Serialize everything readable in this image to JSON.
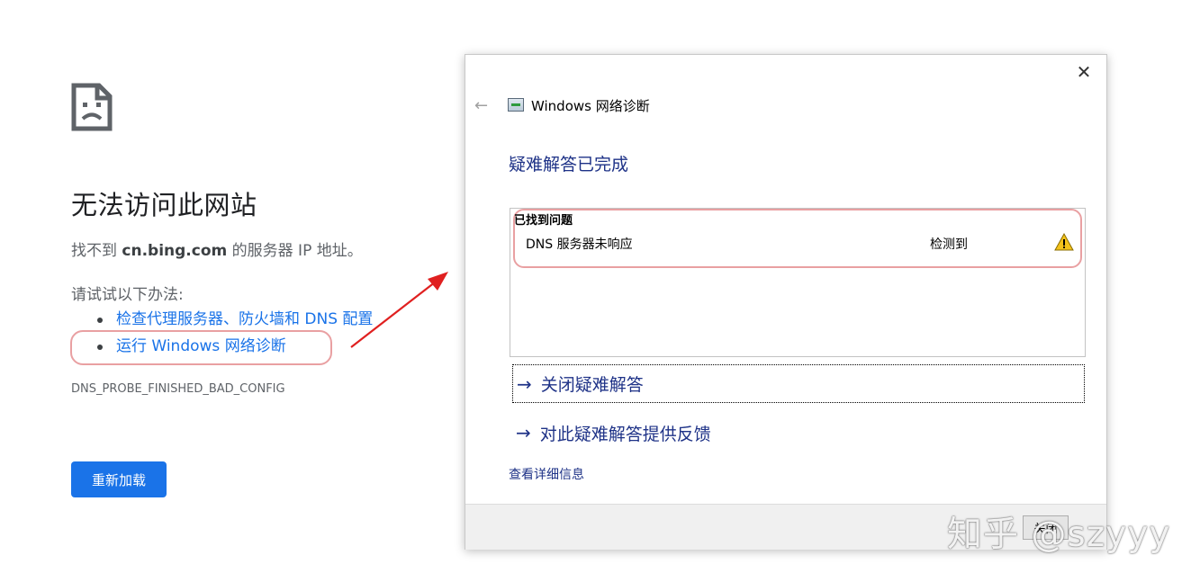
{
  "error_page": {
    "icon": "sad-page-icon",
    "title": "无法访问此网站",
    "message_prefix": "找不到 ",
    "message_host": "cn.bing.com",
    "message_suffix": " 的服务器 IP 地址。",
    "try_label": "请试试以下办法:",
    "suggestions": [
      "检查代理服务器、防火墙和 DNS 配置",
      "运行 Windows 网络诊断"
    ],
    "error_code": "DNS_PROBE_FINISHED_BAD_CONFIG",
    "reload_label": "重新加载",
    "accent_color": "#1a73e8"
  },
  "dialog": {
    "title": "Windows 网络诊断",
    "heading": "疑难解答已完成",
    "problems_header": "已找到问题",
    "problems": [
      {
        "name": "DNS 服务器未响应",
        "status": "检测到",
        "icon": "warning-icon"
      }
    ],
    "actions": [
      "关闭疑难解答",
      "对此疑难解答提供反馈"
    ],
    "details_link": "查看详细信息",
    "close_button": "关闭",
    "link_color": "#1e3287"
  },
  "annotation": {
    "highlight_color": "#e9a0a2",
    "arrow_color": "#e02020"
  },
  "watermark": "知乎 @szyyy"
}
